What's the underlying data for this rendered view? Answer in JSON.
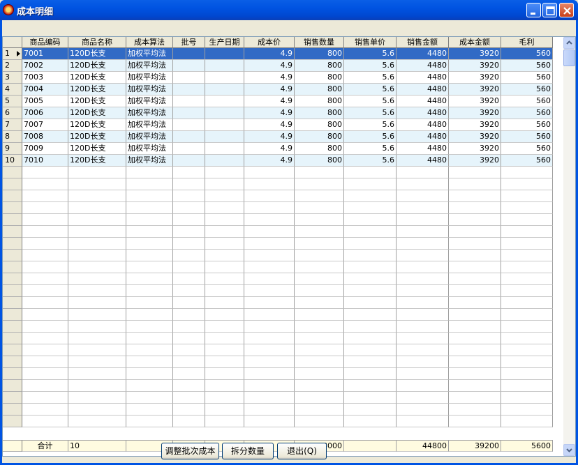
{
  "window": {
    "title": "成本明细"
  },
  "grid": {
    "columns": [
      "商品编码",
      "商品名称",
      "成本算法",
      "批号",
      "生产日期",
      "成本价",
      "销售数量",
      "销售单价",
      "销售金额",
      "成本金额",
      "毛利"
    ],
    "rows": [
      [
        "1",
        "7001",
        "120D长支",
        "加权平均法",
        "",
        "",
        "4.9",
        "800",
        "5.6",
        "4480",
        "3920",
        "560"
      ],
      [
        "2",
        "7002",
        "120D长支",
        "加权平均法",
        "",
        "",
        "4.9",
        "800",
        "5.6",
        "4480",
        "3920",
        "560"
      ],
      [
        "3",
        "7003",
        "120D长支",
        "加权平均法",
        "",
        "",
        "4.9",
        "800",
        "5.6",
        "4480",
        "3920",
        "560"
      ],
      [
        "4",
        "7004",
        "120D长支",
        "加权平均法",
        "",
        "",
        "4.9",
        "800",
        "5.6",
        "4480",
        "3920",
        "560"
      ],
      [
        "5",
        "7005",
        "120D长支",
        "加权平均法",
        "",
        "",
        "4.9",
        "800",
        "5.6",
        "4480",
        "3920",
        "560"
      ],
      [
        "6",
        "7006",
        "120D长支",
        "加权平均法",
        "",
        "",
        "4.9",
        "800",
        "5.6",
        "4480",
        "3920",
        "560"
      ],
      [
        "7",
        "7007",
        "120D长支",
        "加权平均法",
        "",
        "",
        "4.9",
        "800",
        "5.6",
        "4480",
        "3920",
        "560"
      ],
      [
        "8",
        "7008",
        "120D长支",
        "加权平均法",
        "",
        "",
        "4.9",
        "800",
        "5.6",
        "4480",
        "3920",
        "560"
      ],
      [
        "9",
        "7009",
        "120D长支",
        "加权平均法",
        "",
        "",
        "4.9",
        "800",
        "5.6",
        "4480",
        "3920",
        "560"
      ],
      [
        "10",
        "7010",
        "120D长支",
        "加权平均法",
        "",
        "",
        "4.9",
        "800",
        "5.6",
        "4480",
        "3920",
        "560"
      ]
    ],
    "empty_rows": 22,
    "total": {
      "label": "合计",
      "count": "10",
      "qty": "8000",
      "sales_amount": "44800",
      "cost_amount": "39200",
      "profit": "5600"
    }
  },
  "buttons": {
    "adjust": "调整批次成本",
    "split": "拆分数量",
    "exit": "退出(Q)"
  },
  "colors": {
    "title_bar": "#0054e3",
    "selected_row": "#316ac5",
    "alt_row": "#e6f4fb",
    "total_row": "#fffbe0"
  }
}
